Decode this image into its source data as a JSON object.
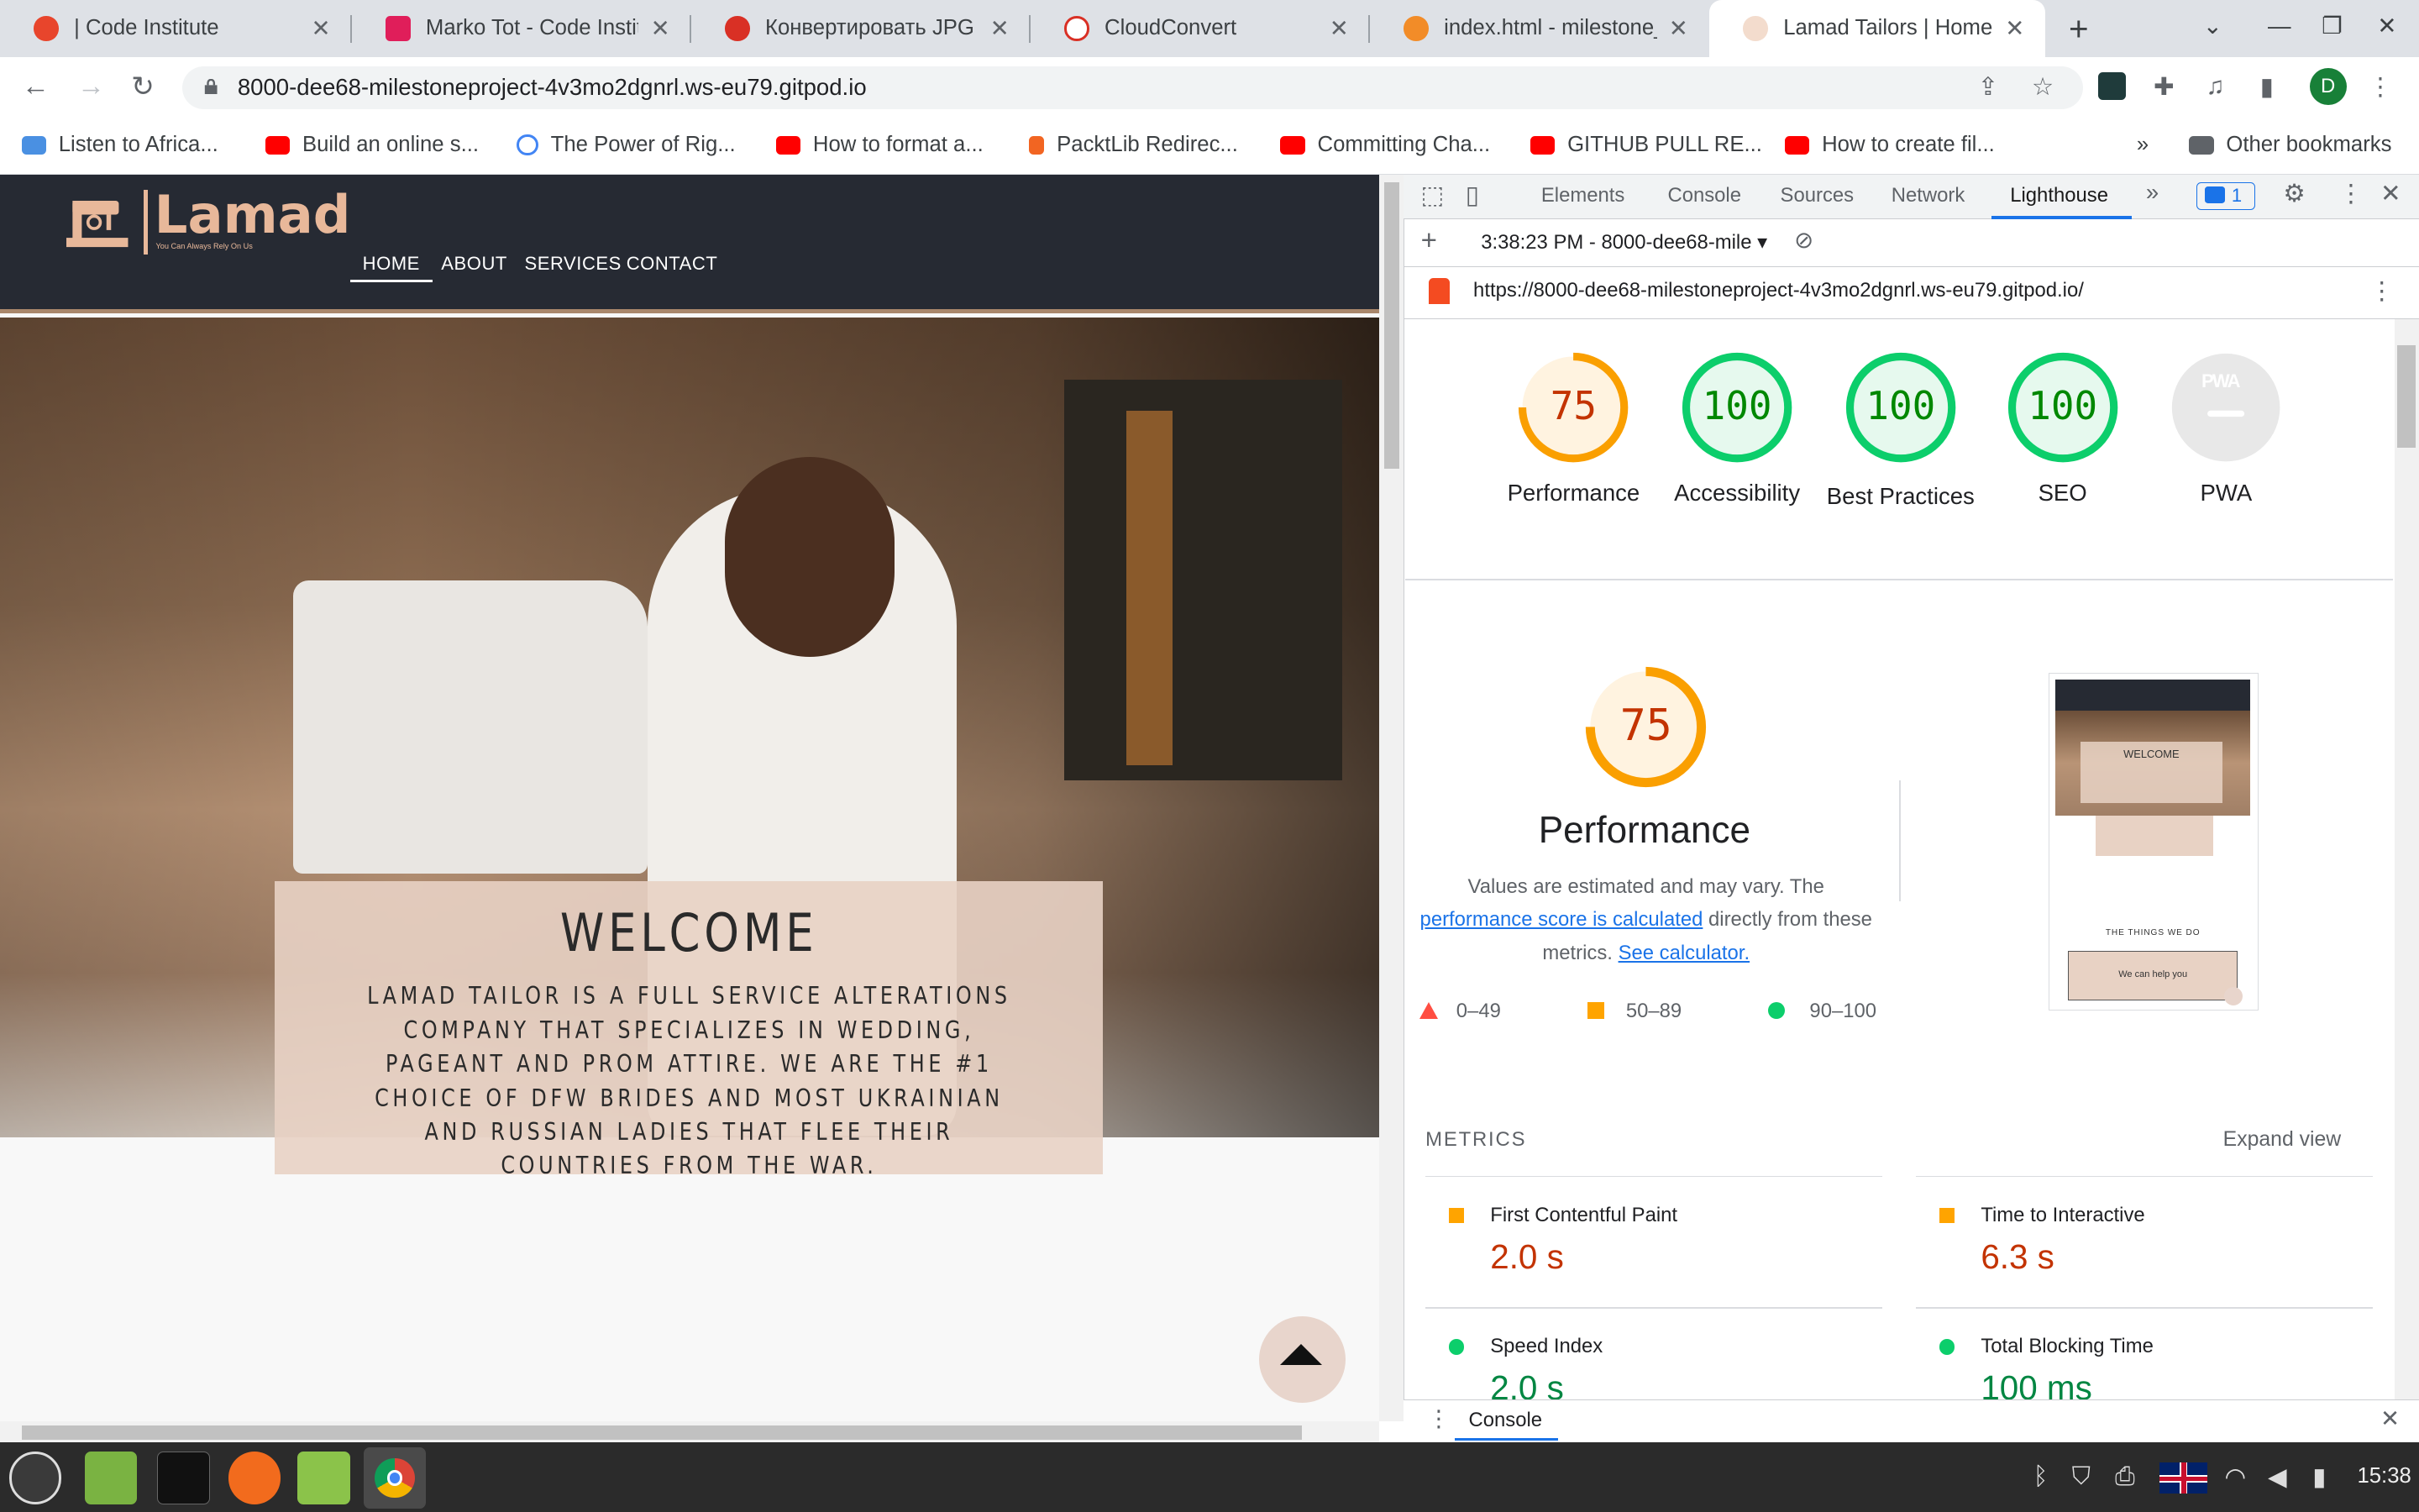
{
  "browser": {
    "tabs": [
      {
        "label": "| Code Institute",
        "favicon_color": "#e8452c"
      },
      {
        "label": "Marko Tot - Code Institu",
        "favicon_color": "#e01e5a"
      },
      {
        "label": "Конвертировать JPG в",
        "favicon_color": "#d93025"
      },
      {
        "label": "CloudConvert",
        "favicon_color": "#9aa0a6"
      },
      {
        "label": "index.html - milestone_",
        "favicon_color": "#f28c28"
      },
      {
        "label": "Lamad Tailors | Home",
        "favicon_color": "#e8b89a"
      }
    ],
    "url": "8000-dee68-milestoneproject-4v3mo2dgnrl.ws-eu79.gitpod.io",
    "avatar_letter": "D",
    "bookmarks": [
      {
        "label": "Listen to Africa...",
        "icon_color": "#4a90e2"
      },
      {
        "label": "Build an online s...",
        "icon_color": "#ff0000"
      },
      {
        "label": "The Power of Rig...",
        "icon_color": "#4285f4"
      },
      {
        "label": "How to format a...",
        "icon_color": "#ff0000"
      },
      {
        "label": "PacktLib Redirec...",
        "icon_color": "#f26522"
      },
      {
        "label": "Committing Cha...",
        "icon_color": "#ff0000"
      },
      {
        "label": "GITHUB PULL RE...",
        "icon_color": "#ff0000"
      },
      {
        "label": "How to create fil...",
        "icon_color": "#ff0000"
      }
    ],
    "other_bookmarks": "Other bookmarks",
    "overflow": "»"
  },
  "site": {
    "logo": "Lamad",
    "tagline": "You Can Always Rely On Us",
    "nav": [
      "HOME",
      "ABOUT",
      "SERVICES",
      "CONTACT"
    ],
    "welcome_title": "WELCOME",
    "welcome_text": "LAMAD TAILOR IS A FULL SERVICE ALTERATIONS COMPANY THAT SPECIALIZES IN WEDDING, PAGEANT AND PROM ATTIRE. WE ARE THE #1 CHOICE OF DFW BRIDES AND MOST UKRAINIAN AND RUSSIAN LADIES THAT FLEE THEIR COUNTRIES FROM THE WAR."
  },
  "devtools": {
    "tabs": [
      "Elements",
      "Console",
      "Sources",
      "Network",
      "Lighthouse"
    ],
    "more": "»",
    "issues_count": "1",
    "report_select": "3:38:23 PM - 8000-dee68-mile",
    "report_url": "https://8000-dee68-milestoneproject-4v3mo2dgnrl.ws-eu79.gitpod.io/",
    "scores": [
      {
        "label": "Performance",
        "value": "75",
        "score": 0.75,
        "color": "#fa9f00",
        "fill": "#fff3e0"
      },
      {
        "label": "Accessibility",
        "value": "100",
        "score": 1.0,
        "color": "#0cce6b",
        "fill": "#e6f9ee"
      },
      {
        "label": "Best Practices",
        "value": "100",
        "score": 1.0,
        "color": "#0cce6b",
        "fill": "#e6f9ee"
      },
      {
        "label": "SEO",
        "value": "100",
        "score": 1.0,
        "color": "#0cce6b",
        "fill": "#e6f9ee"
      },
      {
        "label": "PWA",
        "value": "PWA",
        "score": 0,
        "color": "#c4c4c4",
        "fill": "#e8e8e8"
      }
    ],
    "perf": {
      "score": "75",
      "title": "Performance",
      "desc1": "Values are estimated and may vary. The",
      "link1": "performance score is calculated",
      "desc2": "directly from these metrics.",
      "link2": "See calculator."
    },
    "legend": [
      {
        "range": "0–49",
        "color": "#ff4e42",
        "shape": "triangle"
      },
      {
        "range": "50–89",
        "color": "#ffa400",
        "shape": "square"
      },
      {
        "range": "90–100",
        "color": "#0cce6b",
        "shape": "circle"
      }
    ],
    "thumb": {
      "welcome": "WELCOME",
      "things": "THE THINGS WE DO",
      "help": "We can help you"
    },
    "metrics_title": "METRICS",
    "expand_view": "Expand view",
    "metrics": [
      {
        "name": "First Contentful Paint",
        "value": "2.0 s",
        "color": "#c33300",
        "marker": "#ffa400"
      },
      {
        "name": "Time to Interactive",
        "value": "6.3 s",
        "color": "#c33300",
        "marker": "#ffa400"
      },
      {
        "name": "Speed Index",
        "value": "2.0 s",
        "color": "#018642",
        "marker": "#0cce6b"
      },
      {
        "name": "Total Blocking Time",
        "value": "100 ms",
        "color": "#018642",
        "marker": "#0cce6b"
      }
    ],
    "console_label": "Console"
  },
  "taskbar": {
    "clock": "15:38",
    "apps": [
      {
        "name": "mint-menu",
        "color": "#3a3a3a"
      },
      {
        "name": "files-green",
        "color": "#7ab342"
      },
      {
        "name": "terminal",
        "color": "#111111"
      },
      {
        "name": "firefox",
        "color": "#f26b1d"
      },
      {
        "name": "files",
        "color": "#8bc34a"
      },
      {
        "name": "chrome",
        "color": "#4285f4"
      }
    ]
  }
}
